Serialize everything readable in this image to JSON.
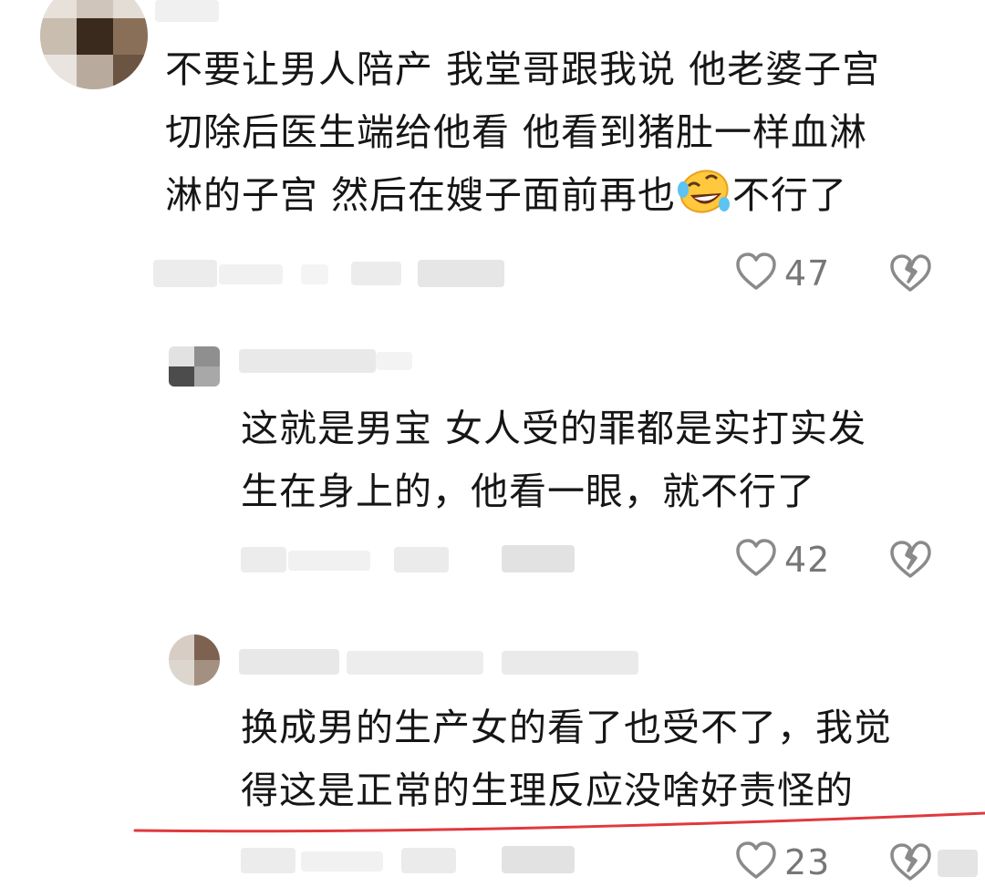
{
  "comment": {
    "lines": [
      "不要让男人陪产 我堂哥跟我说 他老婆子宫",
      "切除后医生端给他看 他看到猪肚一样血淋"
    ],
    "line3_before_emoji": "淋的子宫 然后在嫂子面前再也",
    "line3_after_emoji": "不行了",
    "emoji_icon": "rolling-on-floor-laughing-emoji",
    "likes": "47"
  },
  "replies": [
    {
      "lines": [
        "这就是男宝 女人受的罪都是实打实发",
        "生在身上的，他看一眼，就不行了"
      ],
      "likes": "42"
    },
    {
      "lines": [
        "换成男的生产女的看了也受不了，我觉",
        "得这是正常的生理反应没啥好责怪的"
      ],
      "likes": "23"
    }
  ],
  "icons": {
    "like": "heart-outline-icon",
    "dislike": "broken-heart-icon"
  },
  "colors": {
    "text": "#161616",
    "count": "#777777",
    "icon": "#8a8a8a",
    "annotation": "#e0393e"
  }
}
